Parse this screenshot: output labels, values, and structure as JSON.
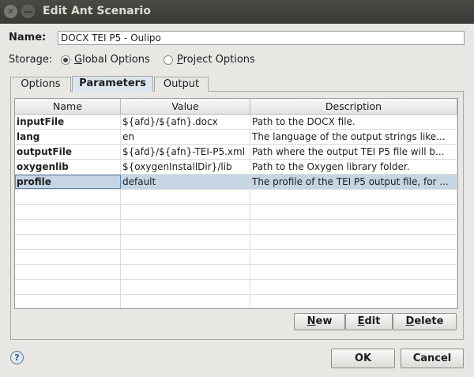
{
  "window": {
    "title": "Edit Ant Scenario"
  },
  "name": {
    "label": "Name:",
    "value": "DOCX TEI P5 - Oulipo"
  },
  "storage": {
    "label": "Storage:",
    "options": [
      {
        "mnemonic": "G",
        "rest": "lobal Options",
        "selected": true
      },
      {
        "mnemonic": "P",
        "rest": "roject Options",
        "selected": false
      }
    ]
  },
  "tabs": [
    {
      "label": "Options",
      "active": false
    },
    {
      "label": "Parameters",
      "active": true
    },
    {
      "label": "Output",
      "active": false
    }
  ],
  "table": {
    "columns": [
      "Name",
      "Value",
      "Description"
    ],
    "rows": [
      {
        "name": "inputFile",
        "value": "${afd}/${afn}.docx",
        "description": "Path to the DOCX file."
      },
      {
        "name": "lang",
        "value": "en",
        "description": "The language of the output strings like..."
      },
      {
        "name": "outputFile",
        "value": "${afd}/${afn}-TEI-P5.xml",
        "description": "Path where the output TEI P5 file will b..."
      },
      {
        "name": "oxygenlib",
        "value": "${oxygenInstallDir}/lib",
        "description": "Path to the Oxygen library folder."
      },
      {
        "name": "profile",
        "value": "default",
        "description": "The profile of the TEI P5 output file, for ...",
        "selected": true
      }
    ]
  },
  "buttons": {
    "new": {
      "mnemonic": "N",
      "rest": "ew"
    },
    "edit": {
      "mnemonic": "E",
      "rest": "dit"
    },
    "delete": {
      "mnemonic": "D",
      "rest": "elete"
    },
    "ok": "OK",
    "cancel": "Cancel"
  },
  "icons": {
    "help": "help-icon",
    "close": "close-icon",
    "minimize": "minimize-icon"
  },
  "help_glyph": "?",
  "close_glyph": "✕"
}
